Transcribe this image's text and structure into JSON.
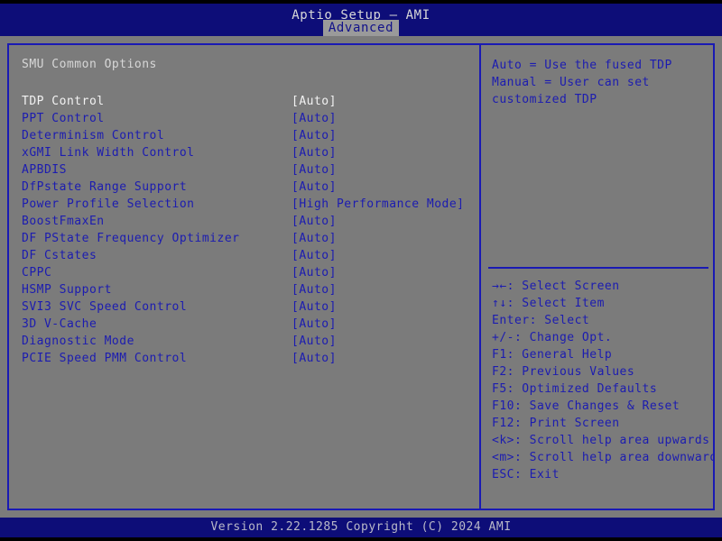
{
  "window": {
    "title": "Aptio Setup – AMI"
  },
  "menubar": {
    "tabs": [
      {
        "label": "Advanced",
        "active": true
      }
    ]
  },
  "main": {
    "section_title": "SMU Common Options",
    "options": [
      {
        "label": "TDP Control",
        "value": "[Auto]",
        "selected": true
      },
      {
        "label": "PPT Control",
        "value": "[Auto]",
        "selected": false
      },
      {
        "label": "Determinism Control",
        "value": "[Auto]",
        "selected": false
      },
      {
        "label": "xGMI Link Width Control",
        "value": "[Auto]",
        "selected": false
      },
      {
        "label": "APBDIS",
        "value": "[Auto]",
        "selected": false
      },
      {
        "label": "DfPstate Range Support",
        "value": "[Auto]",
        "selected": false
      },
      {
        "label": "Power Profile Selection",
        "value": "[High Performance Mode]",
        "selected": false
      },
      {
        "label": "BoostFmaxEn",
        "value": "[Auto]",
        "selected": false
      },
      {
        "label": "DF PState Frequency Optimizer",
        "value": "[Auto]",
        "selected": false
      },
      {
        "label": "DF Cstates",
        "value": "[Auto]",
        "selected": false
      },
      {
        "label": "CPPC",
        "value": "[Auto]",
        "selected": false
      },
      {
        "label": "HSMP Support",
        "value": "[Auto]",
        "selected": false
      },
      {
        "label": "SVI3 SVC Speed Control",
        "value": "[Auto]",
        "selected": false
      },
      {
        "label": "3D V-Cache",
        "value": "[Auto]",
        "selected": false
      },
      {
        "label": "Diagnostic Mode",
        "value": "[Auto]",
        "selected": false
      },
      {
        "label": "PCIE Speed PMM Control",
        "value": "[Auto]",
        "selected": false
      }
    ]
  },
  "help": {
    "text": "Auto = Use the fused TDP\nManual = User can set\ncustomized TDP"
  },
  "keys": [
    {
      "key": "→←",
      "desc": ": Select Screen"
    },
    {
      "key": "↑↓",
      "desc": ": Select Item"
    },
    {
      "key": "Enter",
      "desc": ": Select"
    },
    {
      "key": "+/-",
      "desc": ": Change Opt."
    },
    {
      "key": "F1",
      "desc": ": General Help"
    },
    {
      "key": "F2",
      "desc": ": Previous Values"
    },
    {
      "key": "F5",
      "desc": ": Optimized Defaults"
    },
    {
      "key": "F10",
      "desc": ": Save Changes & Reset"
    },
    {
      "key": "F12",
      "desc": ": Print Screen"
    },
    {
      "key": "<k>",
      "desc": ": Scroll help area upwards"
    },
    {
      "key": "<m>",
      "desc": ": Scroll help area downwards"
    },
    {
      "key": "ESC",
      "desc": ": Exit"
    }
  ],
  "footer": {
    "version_text": "Version 2.22.1285 Copyright (C) 2024 AMI"
  },
  "colors": {
    "background": "#7b7b7b",
    "header_blue": "#0d0d78",
    "border_blue": "#1a1ab4",
    "text_blue": "#1c1cb0",
    "text_selected": "#f2f2f2",
    "tab_active_bg": "#9a9a9a"
  }
}
